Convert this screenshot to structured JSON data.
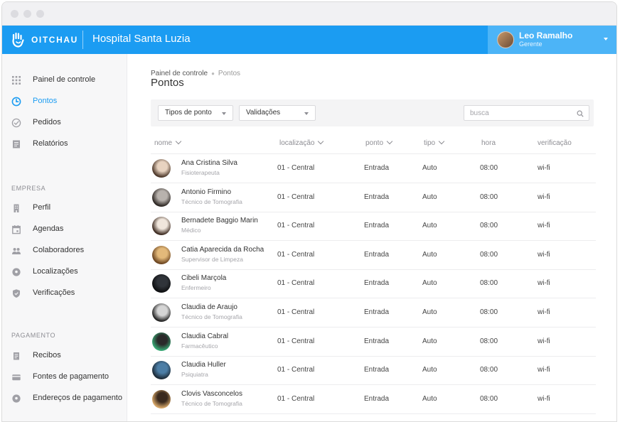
{
  "app": {
    "brand": "OITCHAU",
    "hospital": "Hospital Santa Luzia",
    "accent_color": "#1b9cf2",
    "user": {
      "name": "Leo Ramalho",
      "role": "Gerente"
    }
  },
  "sidebar": {
    "main_items": [
      {
        "label": "Painel de controle",
        "icon": "grid-icon",
        "active": false
      },
      {
        "label": "Pontos",
        "icon": "clock-icon",
        "active": true
      },
      {
        "label": "Pedidos",
        "icon": "check-circle-icon",
        "active": false
      },
      {
        "label": "Relatórios",
        "icon": "report-icon",
        "active": false
      }
    ],
    "empresa_title": "EMPRESA",
    "empresa_items": [
      {
        "label": "Perfil",
        "icon": "building-icon"
      },
      {
        "label": "Agendas",
        "icon": "calendar-icon"
      },
      {
        "label": "Colaboradores",
        "icon": "people-icon"
      },
      {
        "label": "Localizações",
        "icon": "location-pin-icon"
      },
      {
        "label": "Verificações",
        "icon": "shield-icon"
      }
    ],
    "pagamento_title": "PAGAMENTO",
    "pagamento_items": [
      {
        "label": "Recibos",
        "icon": "receipt-icon"
      },
      {
        "label": "Fontes de pagamento",
        "icon": "credit-card-icon"
      },
      {
        "label": "Endereços de pagamento",
        "icon": "location-pin-icon"
      }
    ]
  },
  "breadcrumb": {
    "parent": "Painel de controle",
    "current": "Pontos"
  },
  "page_title": "Pontos",
  "filters": {
    "tipos": "Tipos de ponto",
    "validacoes": "Validações",
    "search_placeholder": "busca"
  },
  "table": {
    "columns": [
      "nome",
      "localização",
      "ponto",
      "tipo",
      "hora",
      "verificação"
    ],
    "rows": [
      {
        "name": "Ana Cristina Silva",
        "role": "Fisioterapeuta",
        "loc": "01 - Central",
        "ponto": "Entrada",
        "tipo": "Auto",
        "hora": "08:00",
        "verif": "wi-fi"
      },
      {
        "name": "Antonio Firmino",
        "role": "Técnico de Tomografia",
        "loc": "01 - Central",
        "ponto": "Entrada",
        "tipo": "Auto",
        "hora": "08:00",
        "verif": "wi-fi"
      },
      {
        "name": "Bernadete Baggio Marin",
        "role": "Médico",
        "loc": "01 - Central",
        "ponto": "Entrada",
        "tipo": "Auto",
        "hora": "08:00",
        "verif": "wi-fi"
      },
      {
        "name": "Catia Aparecida da Rocha",
        "role": "Supervisor de Limpeza",
        "loc": "01 - Central",
        "ponto": "Entrada",
        "tipo": "Auto",
        "hora": "08:00",
        "verif": "wi-fi"
      },
      {
        "name": "Cibeli Marçola",
        "role": "Enfermeiro",
        "loc": "01 - Central",
        "ponto": "Entrada",
        "tipo": "Auto",
        "hora": "08:00",
        "verif": "wi-fi"
      },
      {
        "name": "Claudia de Araujo",
        "role": "Técnico de Tomografia",
        "loc": "01 - Central",
        "ponto": "Entrada",
        "tipo": "Auto",
        "hora": "08:00",
        "verif": "wi-fi"
      },
      {
        "name": "Claudia Cabral",
        "role": "Farmacêutico",
        "loc": "01 - Central",
        "ponto": "Entrada",
        "tipo": "Auto",
        "hora": "08:00",
        "verif": "wi-fi"
      },
      {
        "name": "Claudia Huller",
        "role": "Psiquiatra",
        "loc": "01 - Central",
        "ponto": "Entrada",
        "tipo": "Auto",
        "hora": "08:00",
        "verif": "wi-fi"
      },
      {
        "name": "Clovis Vasconcelos",
        "role": "Técnico de Tomografia",
        "loc": "01 - Central",
        "ponto": "Entrada",
        "tipo": "Auto",
        "hora": "08:00",
        "verif": "wi-fi"
      }
    ]
  }
}
